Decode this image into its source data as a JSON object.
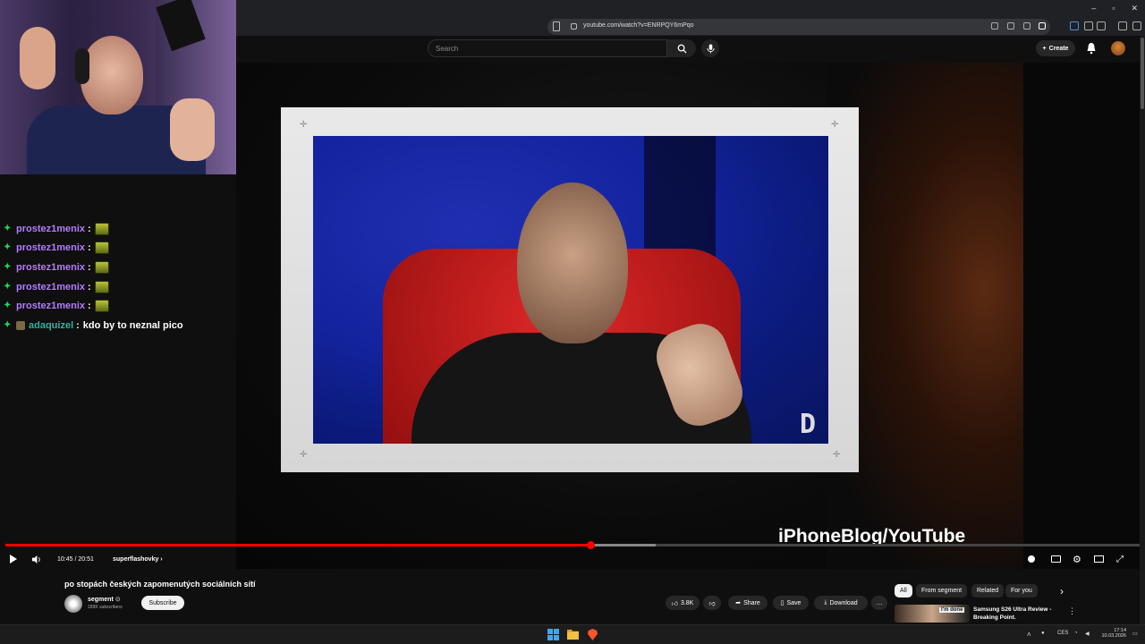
{
  "browser": {
    "url": "youtube.com/watch?v=ENRPQY6mPqo",
    "window_controls": [
      "–",
      "▫",
      "✕"
    ]
  },
  "youtube": {
    "search_placeholder": "Search",
    "create_label": "Create"
  },
  "chat": {
    "lines": [
      {
        "user": "prostez1menix",
        "message": ""
      },
      {
        "user": "prostez1menix",
        "message": ""
      },
      {
        "user": "prostez1menix",
        "message": ""
      },
      {
        "user": "prostez1menix",
        "message": ""
      },
      {
        "user": "prostez1menix",
        "message": ""
      },
      {
        "user": "adaquizel",
        "message": "kdo by to neznal pico"
      }
    ]
  },
  "video": {
    "credit": "iPhoneBlog/YouTube",
    "corner_logo": "D",
    "time": "10:45 / 20:51",
    "chapter": "superflashovky",
    "progress_fraction": 0.516,
    "buffered_fraction": 0.573
  },
  "info": {
    "title": "po stopách českých zapomenutých sociálních sítí",
    "channel": "segment",
    "verified_mark": "⊙",
    "subscribers": "189K subscribers",
    "subscribe_label": "Subscribe",
    "likes": "3.8K",
    "share_label": "Share",
    "save_label": "Save",
    "download_label": "Download",
    "more_label": "…"
  },
  "recommend": {
    "chips": [
      "All",
      "From segment",
      "Related",
      "For you"
    ],
    "next_arrow": "›",
    "thumb_text": "I'm done",
    "title": "Samsung S26 Ultra Review - Breaking Point."
  },
  "taskbar": {
    "language": "CES",
    "time": "17:14",
    "date": "10.03.2026"
  },
  "colors": {
    "accent": "#ff0000",
    "chat_purple": "#b47bff",
    "chat_teal": "#2bb3a0"
  }
}
